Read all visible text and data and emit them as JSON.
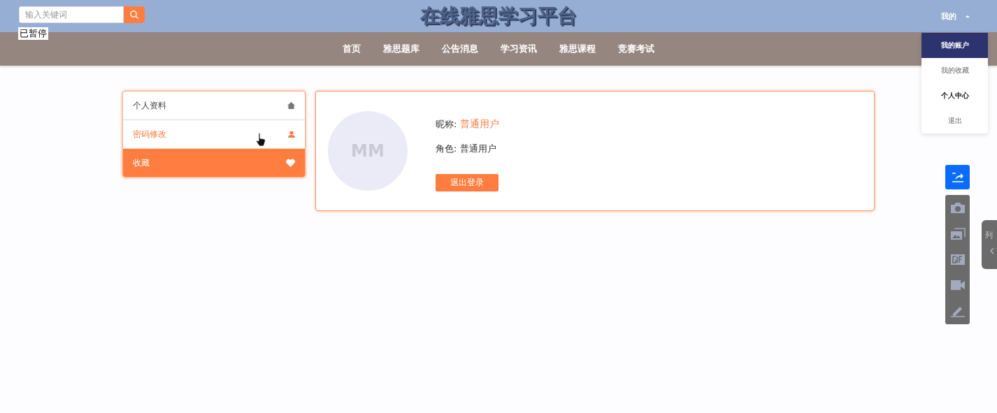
{
  "header": {
    "search": {
      "placeholder": "输入关键词"
    },
    "paused_label": "已暂停",
    "site_title": "在线雅思学习平台",
    "account_menu": {
      "label": "我的",
      "expanded": true,
      "items": [
        {
          "label": "我的账户",
          "selected": true,
          "bold": false
        },
        {
          "label": "我的收藏",
          "selected": false,
          "bold": false
        },
        {
          "label": "个人中心",
          "selected": false,
          "bold": true
        },
        {
          "label": "退出",
          "selected": false,
          "bold": false
        }
      ]
    }
  },
  "nav": {
    "items": [
      "首页",
      "雅思题库",
      "公告消息",
      "学习资讯",
      "雅思课程",
      "竞赛考试"
    ]
  },
  "sidebar": {
    "items": [
      {
        "label": "个人资料",
        "selected": false,
        "highlighted": false
      },
      {
        "label": "密码修改",
        "selected": false,
        "highlighted": true
      },
      {
        "label": "收藏",
        "selected": true,
        "highlighted": false
      }
    ]
  },
  "profile": {
    "avatar_initials": "MM",
    "nickname_label": "昵称:",
    "nickname": "普通用户",
    "role_label": "角色:",
    "role": "普通用户",
    "logout_button": "退出登录"
  },
  "side_panel": {
    "label": "列"
  }
}
